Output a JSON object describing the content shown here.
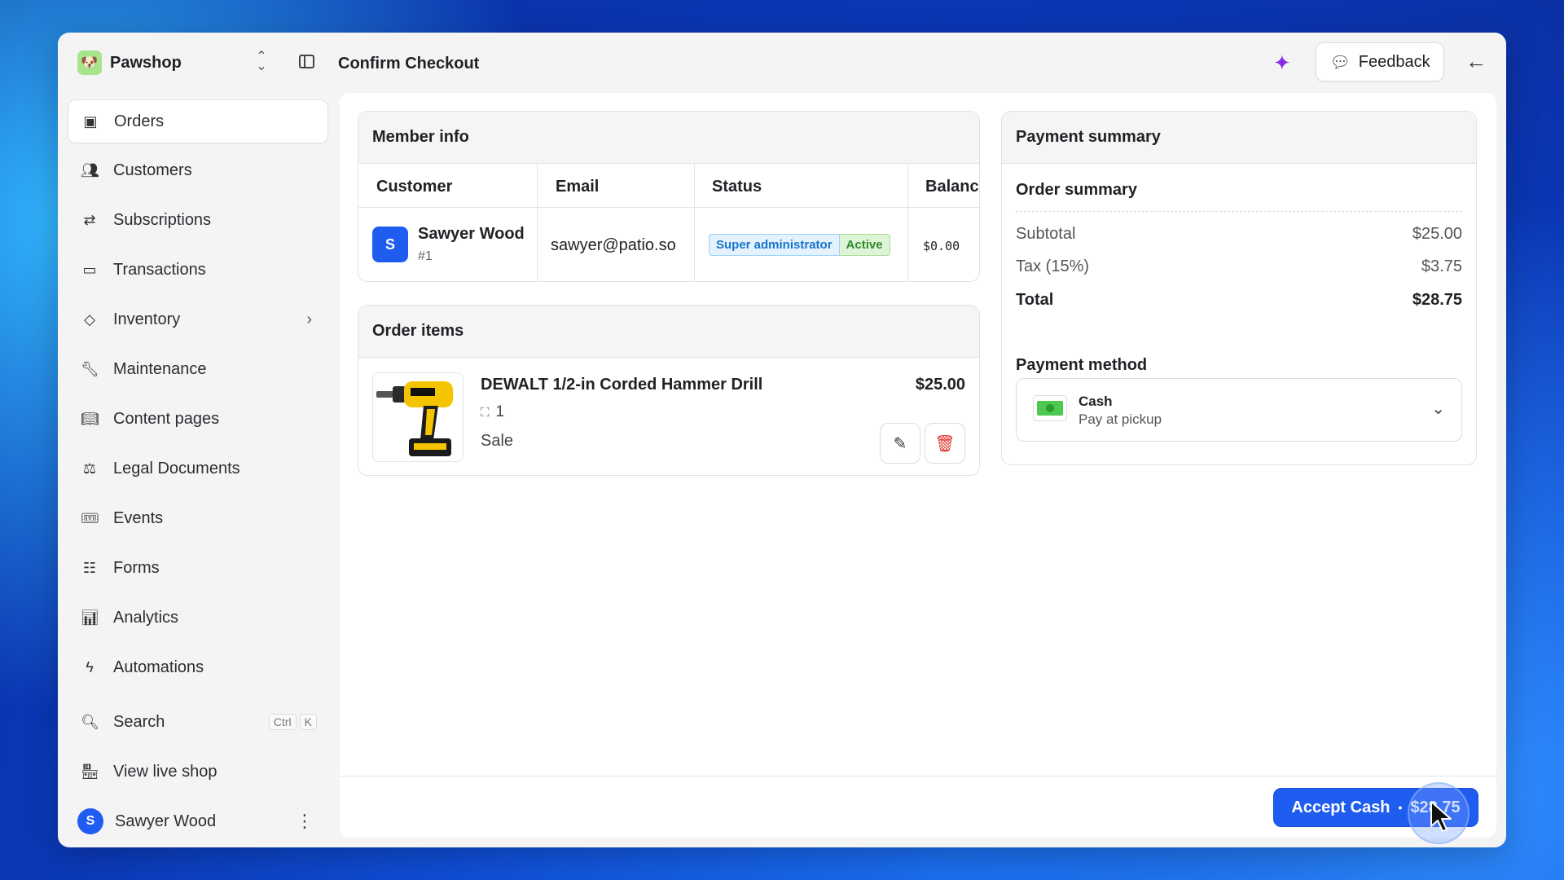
{
  "app": {
    "brand": "Pawshop",
    "page_title": "Confirm Checkout",
    "feedback_label": "Feedback"
  },
  "sidebar": {
    "items": [
      {
        "label": "Orders",
        "icon": "inbox-icon",
        "active": true
      },
      {
        "label": "Customers",
        "icon": "users-icon"
      },
      {
        "label": "Subscriptions",
        "icon": "repeat-icon"
      },
      {
        "label": "Transactions",
        "icon": "credit-card-icon"
      },
      {
        "label": "Inventory",
        "icon": "tag-icon"
      },
      {
        "label": "Maintenance",
        "icon": "wrench-icon"
      },
      {
        "label": "Content pages",
        "icon": "book-icon"
      },
      {
        "label": "Legal Documents",
        "icon": "scale-icon"
      },
      {
        "label": "Events",
        "icon": "ticket-icon"
      },
      {
        "label": "Forms",
        "icon": "form-icon"
      },
      {
        "label": "Analytics",
        "icon": "bar-chart-icon"
      },
      {
        "label": "Automations",
        "icon": "lightning-icon"
      }
    ],
    "search": {
      "label": "Search",
      "shortcut": [
        "Ctrl",
        "K"
      ]
    },
    "live_shop": "View live shop",
    "user": {
      "initial": "S",
      "name": "Sawyer Wood"
    }
  },
  "member_info": {
    "title": "Member info",
    "columns": [
      "Customer",
      "Email",
      "Status",
      "Balance"
    ],
    "row": {
      "initial": "S",
      "name": "Sawyer Wood",
      "id": "#1",
      "email": "sawyer@patio.so",
      "role": "Super administrator",
      "status": "Active",
      "balance": "$0.00"
    }
  },
  "order_items": {
    "title": "Order items",
    "items": [
      {
        "name": "DEWALT 1/2-in Corded Hammer Drill",
        "quantity": "1",
        "type": "Sale",
        "price": "$25.00"
      }
    ]
  },
  "payment_summary": {
    "title": "Payment summary",
    "order_summary_title": "Order summary",
    "subtotal_label": "Subtotal",
    "subtotal": "$25.00",
    "tax_label": "Tax (15%)",
    "tax": "$3.75",
    "total_label": "Total",
    "total": "$28.75",
    "payment_method_title": "Payment method",
    "method": {
      "name": "Cash",
      "description": "Pay at pickup"
    }
  },
  "footer": {
    "accept_label": "Accept Cash",
    "accept_amount": "$28.75"
  },
  "colors": {
    "accent": "#1f5cf0",
    "active_green": "#2f8a2f",
    "role_blue": "#1a74c9",
    "danger": "#e0362c"
  }
}
